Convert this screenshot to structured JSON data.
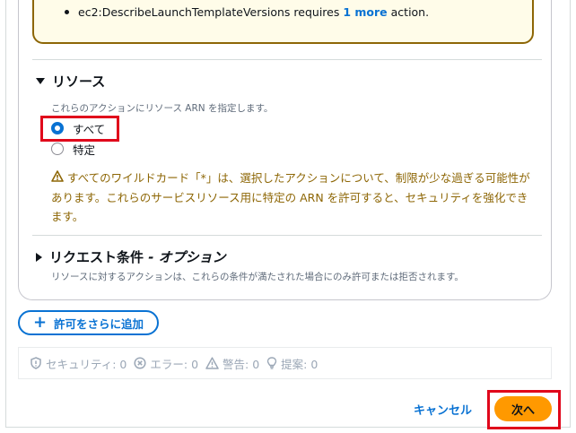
{
  "warning_box": {
    "action_text": "ec2:DescribeLaunchTemplateVersions requires ",
    "more_link": "1 more",
    "action_suffix": " action."
  },
  "resources": {
    "title": "リソース",
    "description": "これらのアクションにリソース ARN を指定します。",
    "options": [
      "すべて",
      "特定"
    ],
    "selected": "すべて",
    "caution_line1": "すべてのワイルドカード「*」は、選択したアクションについて、制限が少な過ぎる可能性が",
    "caution_line2": "あります。これらのサービスリソース用に特定の ARN を許可すると、セキュリティを強化でき",
    "caution_line3": "ます。"
  },
  "request_conditions": {
    "title": "リクエスト条件",
    "optional": " - オプション",
    "description": "リソースに対するアクションは、これらの条件が満たされた場合にのみ許可または拒否されます。"
  },
  "add_permission_label": "許可をさらに追加",
  "status": {
    "security": "セキュリティ: 0",
    "errors": "エラー: 0",
    "warnings": "警告: 0",
    "suggestions": "提案: 0"
  },
  "footer": {
    "cancel": "キャンセル",
    "next": "次へ"
  },
  "colors": {
    "accent": "#0972d3",
    "primary_button": "#ff9900",
    "warning": "#8d6605",
    "highlight": "#e0071b"
  }
}
